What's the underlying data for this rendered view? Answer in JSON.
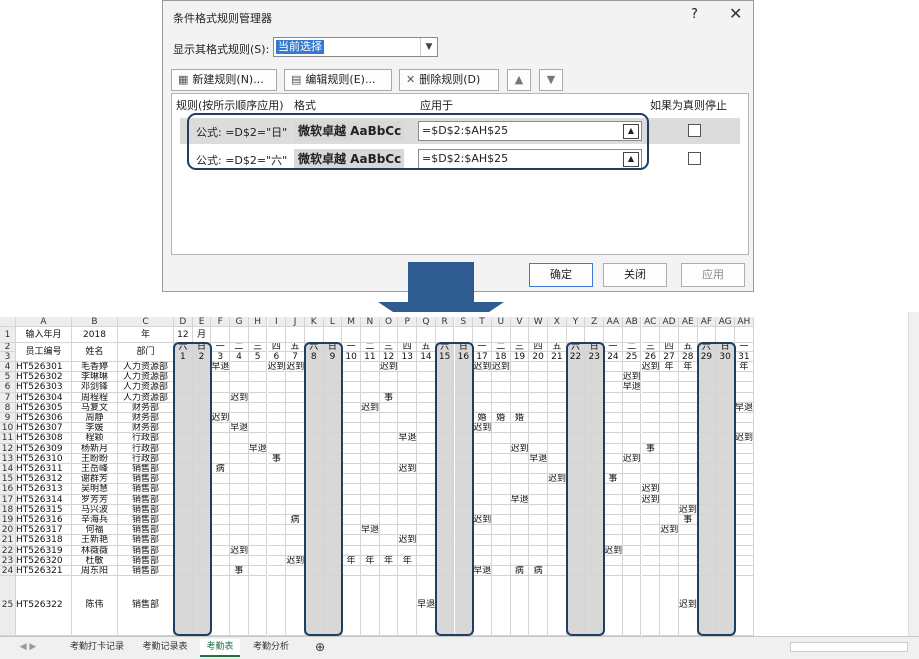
{
  "dialog": {
    "title": "条件格式规则管理器",
    "help": "?",
    "close": "✕",
    "show_label": "显示其格式规则(S):",
    "show_value": "当前选择",
    "btn_new": "新建规则(N)...",
    "btn_edit": "编辑规则(E)...",
    "btn_delete": "删除规则(D)",
    "btn_up": "▲",
    "btn_down": "▼",
    "col_rule": "规则(按所示顺序应用)",
    "col_format": "格式",
    "col_applies": "应用于",
    "col_stop": "如果为真则停止",
    "rules": [
      {
        "formula": "公式: =D$2=\"日\"",
        "preview": "微软卓越 AaBbCc",
        "applies": "=$D$2:$AH$25",
        "stop": false
      },
      {
        "formula": "公式: =D$2=\"六\"",
        "preview": "微软卓越 AaBbCc",
        "applies": "=$D$2:$AH$25",
        "stop": false
      }
    ],
    "btn_ok": "确定",
    "btn_close": "关闭",
    "btn_apply": "应用"
  },
  "sheet": {
    "columns": [
      "A",
      "B",
      "C",
      "D",
      "E",
      "F",
      "G",
      "H",
      "I",
      "J",
      "K",
      "L",
      "M",
      "N",
      "O",
      "P",
      "Q",
      "R",
      "S",
      "T",
      "U",
      "V",
      "W",
      "X",
      "Y",
      "Z",
      "AA",
      "AB",
      "AC",
      "AD",
      "AE",
      "AF",
      "AG",
      "AH"
    ],
    "row_numbers": [
      "1",
      "2",
      "3",
      "4",
      "5",
      "6",
      "7",
      "8",
      "9",
      "10",
      "11",
      "12",
      "13",
      "14",
      "15",
      "16",
      "17",
      "18",
      "19",
      "20",
      "21",
      "22",
      "23",
      "24",
      "25"
    ],
    "row1": [
      "输入年月",
      "2018",
      "年",
      "12",
      "月"
    ],
    "hdr_ab": [
      "员工编号",
      "姓名",
      "部门"
    ],
    "weekdays": [
      "六",
      "日",
      "一",
      "二",
      "三",
      "四",
      "五",
      "六",
      "日",
      "一",
      "二",
      "三",
      "四",
      "五",
      "六",
      "日",
      "一",
      "二",
      "三",
      "四",
      "五",
      "六",
      "日",
      "一",
      "二",
      "三",
      "四",
      "五",
      "六",
      "日",
      "一"
    ],
    "days": [
      "1",
      "2",
      "3",
      "4",
      "5",
      "6",
      "7",
      "8",
      "9",
      "10",
      "11",
      "12",
      "13",
      "14",
      "15",
      "16",
      "17",
      "18",
      "19",
      "20",
      "21",
      "22",
      "23",
      "24",
      "25",
      "26",
      "27",
      "28",
      "29",
      "30",
      "31"
    ],
    "weekend_flags": [
      1,
      1,
      0,
      0,
      0,
      0,
      0,
      1,
      1,
      0,
      0,
      0,
      0,
      0,
      1,
      1,
      0,
      0,
      0,
      0,
      0,
      1,
      1,
      0,
      0,
      0,
      0,
      0,
      1,
      1,
      0
    ],
    "employees": [
      {
        "id": "HT526301",
        "name": "毛香婷",
        "dept": "人力资源部",
        "marks": {
          "3": "早退",
          "6": "迟到",
          "7": "迟到",
          "12": "迟到",
          "17": "迟到",
          "18": "迟到",
          "26": "迟到",
          "27": "年",
          "28": "年",
          "31": "年"
        }
      },
      {
        "id": "HT526302",
        "name": "李琳琳",
        "dept": "人力资源部",
        "marks": {
          "25": "迟到"
        }
      },
      {
        "id": "HT526303",
        "name": "邓剑锋",
        "dept": "人力资源部",
        "marks": {
          "25": "早退"
        }
      },
      {
        "id": "HT526304",
        "name": "周程程",
        "dept": "人力资源部",
        "marks": {
          "4": "迟到",
          "12": "事"
        }
      },
      {
        "id": "HT526305",
        "name": "马复文",
        "dept": "财务部",
        "marks": {
          "11": "迟到",
          "31": "早退"
        }
      },
      {
        "id": "HT526306",
        "name": "周静",
        "dept": "财务部",
        "marks": {
          "3": "迟到",
          "17": "婚",
          "18": "婚",
          "19": "婚"
        }
      },
      {
        "id": "HT526307",
        "name": "李媛",
        "dept": "财务部",
        "marks": {
          "4": "早退",
          "17": "迟到"
        }
      },
      {
        "id": "HT526308",
        "name": "程颖",
        "dept": "行政部",
        "marks": {
          "13": "早退",
          "31": "迟到"
        }
      },
      {
        "id": "HT526309",
        "name": "杨新月",
        "dept": "行政部",
        "marks": {
          "5": "早退",
          "19": "迟到",
          "26": "事"
        }
      },
      {
        "id": "HT526310",
        "name": "王盼盼",
        "dept": "行政部",
        "marks": {
          "6": "事",
          "20": "早退",
          "25": "迟到"
        }
      },
      {
        "id": "HT526311",
        "name": "王岳峰",
        "dept": "销售部",
        "marks": {
          "3": "病",
          "13": "迟到"
        }
      },
      {
        "id": "HT526312",
        "name": "谢群芳",
        "dept": "销售部",
        "marks": {
          "21": "迟到",
          "24": "事"
        }
      },
      {
        "id": "HT526313",
        "name": "吴明慧",
        "dept": "销售部",
        "marks": {
          "26": "迟到"
        }
      },
      {
        "id": "HT526314",
        "name": "罗芳芳",
        "dept": "销售部",
        "marks": {
          "19": "早退",
          "26": "迟到"
        }
      },
      {
        "id": "HT526315",
        "name": "马兴波",
        "dept": "销售部",
        "marks": {
          "28": "迟到"
        }
      },
      {
        "id": "HT526316",
        "name": "辛海兵",
        "dept": "销售部",
        "marks": {
          "7": "病",
          "17": "迟到",
          "28": "事"
        }
      },
      {
        "id": "HT526317",
        "name": "何福",
        "dept": "销售部",
        "marks": {
          "11": "早退",
          "27": "迟到"
        }
      },
      {
        "id": "HT526318",
        "name": "王新艳",
        "dept": "销售部",
        "marks": {
          "13": "迟到"
        }
      },
      {
        "id": "HT526319",
        "name": "林薇薇",
        "dept": "销售部",
        "marks": {
          "4": "迟到",
          "24": "迟到"
        }
      },
      {
        "id": "HT526320",
        "name": "杜敏",
        "dept": "销售部",
        "marks": {
          "7": "迟到",
          "10": "年",
          "11": "年",
          "12": "年",
          "13": "年"
        }
      },
      {
        "id": "HT526321",
        "name": "周东阳",
        "dept": "销售部",
        "marks": {
          "4": "事",
          "17": "早退",
          "19": "病",
          "20": "病"
        }
      },
      {
        "id": "HT526322",
        "name": "陈伟",
        "dept": "销售部",
        "marks": {
          "14": "早退",
          "28": "迟到"
        }
      }
    ],
    "tabs": [
      "考勤打卡记录",
      "考勤记录表",
      "考勤表",
      "考勤分析"
    ],
    "active_tab": "考勤表",
    "add_sheet": "⊕"
  },
  "colors": {
    "accent_box": "#1c3f62",
    "arrow": "#2e5c91",
    "weekend": "#d8d8d8",
    "tab_active": "#217346"
  }
}
